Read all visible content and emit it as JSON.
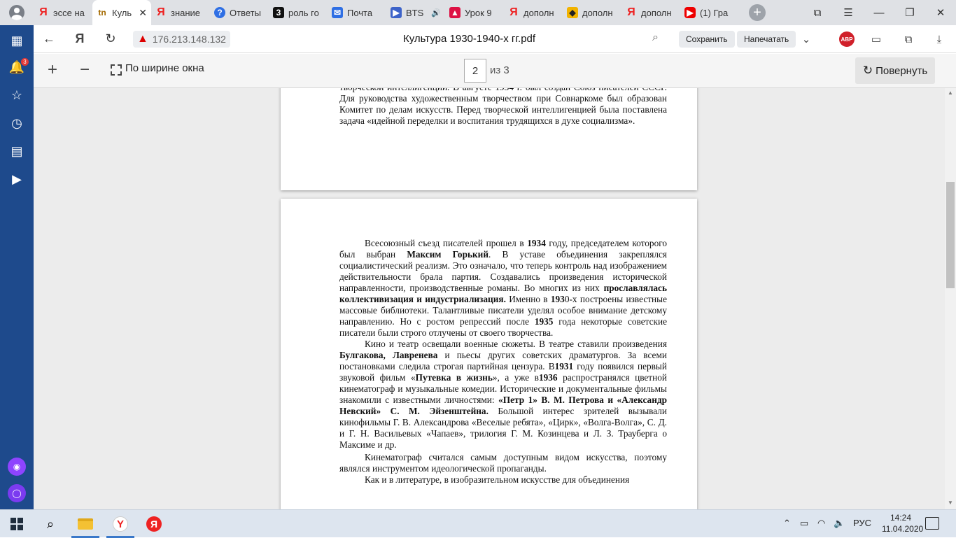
{
  "tabs": [
    {
      "icon": "yandex-icon",
      "glyph": "Я",
      "title": "эссе на"
    },
    {
      "icon": "tn-icon",
      "glyph": "tn",
      "title": "Куль",
      "active": true
    },
    {
      "icon": "yandex-icon",
      "glyph": "Я",
      "title": "знание"
    },
    {
      "icon": "answers-icon",
      "glyph": "?",
      "title": "Ответы"
    },
    {
      "icon": "z-icon",
      "glyph": "3",
      "title": "роль го"
    },
    {
      "icon": "mail-icon",
      "glyph": "✉",
      "title": "Почта"
    },
    {
      "icon": "video-icon",
      "glyph": "▶",
      "title": "BTS"
    },
    {
      "icon": "lesson-icon",
      "glyph": "▲",
      "title": "Урок 9"
    },
    {
      "icon": "yandex-icon",
      "glyph": "Я",
      "title": "дополн"
    },
    {
      "icon": "collections-icon",
      "glyph": "◆",
      "title": "дополн"
    },
    {
      "icon": "yandex-icon",
      "glyph": "Я",
      "title": "дополн"
    },
    {
      "icon": "youtube-icon",
      "glyph": "▶",
      "title": "(1) Гра"
    }
  ],
  "address": {
    "url": "176.213.148.132",
    "page_title": "Культура 1930-1940-х гг.pdf",
    "save_label": "Сохранить",
    "print_label": "Напечатать",
    "abp_label": "ABP"
  },
  "sidebar": {
    "notification_count": "3"
  },
  "pdf_toolbar": {
    "fit_label": "По ширине окна",
    "page_current": "2",
    "page_of": "из 3",
    "rotate_label": "Повернуть"
  },
  "page1": {
    "text": "творческой интеллигенции. В августе 1934 г. был создан Союз писателей СССР. Для руководства художественным творчеством при Совнаркоме был образован Комитет по делам искусств. Перед творческой интеллигенцией была поставлена задача «идейной переделки и воспитания трудящихся в духе социализма»."
  },
  "page2": {
    "p1_a": "Всесоюзный съезд писателей прошел в ",
    "p1_b": "1934",
    "p1_c": " году, председателем которого был выбран ",
    "p1_d": "Максим Горький",
    "p1_e": ". В уставе объединения закреплялся социалистический реализм. Это означало, что теперь контроль над изображением действительности брала партия. Создавались произведения исторической направленности, производственные романы. Во многих из них ",
    "p1_f": "прославлялась коллективизация и индустриализация.",
    "p1_g": " Именно в ",
    "p1_h": "193",
    "p1_i": "0-х построены известные массовые библиотеки. Талантливые писатели уделял особое внимание детскому направлению. Но с ростом репрессий после ",
    "p1_j": "1935",
    "p1_k": " года некоторые советские писатели были строго отлучены от своего творчества.",
    "p2_a": "Кино и театр освещали военные сюжеты. В театре ставили произведения ",
    "p2_b": "Булгакова, Лавренева",
    "p2_c": " и пьесы других советских драматургов. За всеми постановками следила строгая партийная цензура. В",
    "p2_d": "1931",
    "p2_e": " году появился первый звуковой фильм «",
    "p2_f": "Путевка в жизнь",
    "p2_g": "», а уже в",
    "p2_h": "1936",
    "p2_i": " распространялся цветной кинематограф и музыкальные комедии. Исторические и документальные фильмы знакомили с известными личностями: ",
    "p2_j": "«Петр 1» В. М. Петрова и «Александр Невский» С. М. Эйзенштейна.",
    "p2_k": " Большой интерес зрителей вызывали кинофильмы Г. В. Александрова «Веселые ребята», «Цирк», «Волга-Волга», С. Д. и Г. Н. Васильевых «Чапаев», трилогия Г. М. Козинцева и Л. З. Трауберга о Максиме и др.",
    "p3": "Кинематограф считался самым доступным видом искусства, поэтому являлся инструментом идеологической пропаганды.",
    "p4": "Как и в литературе, в изобразительном искусстве для объединения"
  },
  "taskbar": {
    "language": "РУС",
    "time": "14:24",
    "date": "11.04.2020"
  }
}
